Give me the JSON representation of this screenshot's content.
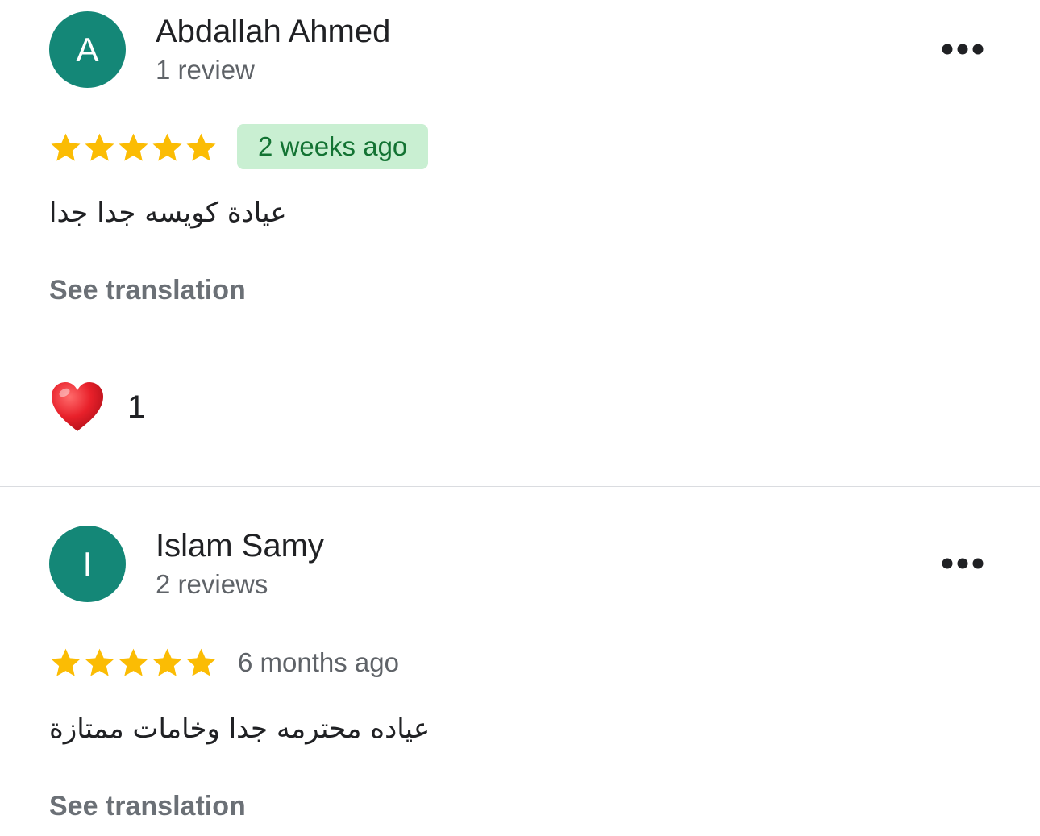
{
  "colors": {
    "avatar_bg": "#148777",
    "star": "#fbbc04",
    "date_badge_bg": "#c9efd2",
    "date_badge_text": "#137333",
    "heart": "#e8202a"
  },
  "icons": {
    "more": "more-horizontal-icon",
    "star": "star-icon",
    "reaction": "red-heart-icon"
  },
  "reviews": [
    {
      "avatar_letter": "A",
      "name": "Abdallah Ahmed",
      "review_count": "1 review",
      "rating": 5,
      "date": "2 weeks ago",
      "date_highlighted": true,
      "text": "عيادة كويسه جدا جدا",
      "translate_label": "See translation",
      "reaction_count": "1"
    },
    {
      "avatar_letter": "I",
      "name": "Islam Samy",
      "review_count": "2 reviews",
      "rating": 5,
      "date": "6 months ago",
      "date_highlighted": false,
      "text": "عياده محترمه جدا وخامات ممتازة",
      "translate_label": "See translation"
    }
  ]
}
